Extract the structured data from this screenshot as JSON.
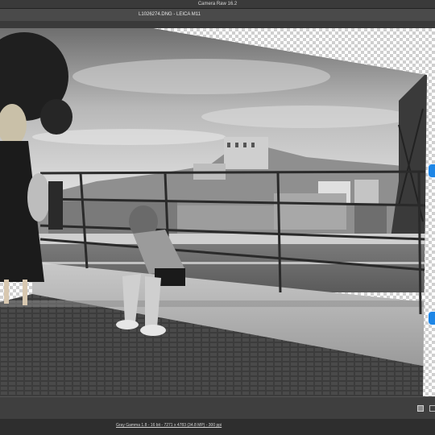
{
  "app": {
    "title": "Camera Raw 16.2"
  },
  "document": {
    "file_info": "L1026274.DNG  -  LEICA M11"
  },
  "status": {
    "workflow_options": "Gray Gamma 1.8 - 16 bit - 7271 x 4783 (34.8 MP) - 300 ppi"
  },
  "photo": {
    "mode": "black-and-white",
    "subjects": [
      "girl-sitting-on-ledge",
      "standing-woman",
      "railing",
      "city-skyline",
      "river",
      "bridge"
    ]
  },
  "colors": {
    "accent": "#1e86e6",
    "panel": "#4a4a4a",
    "titlebar": "#3a3a3a",
    "status": "#2e2e2e"
  },
  "icons": [
    "transform-handle-icon",
    "compare-view-icon",
    "toggle-view-icon"
  ]
}
